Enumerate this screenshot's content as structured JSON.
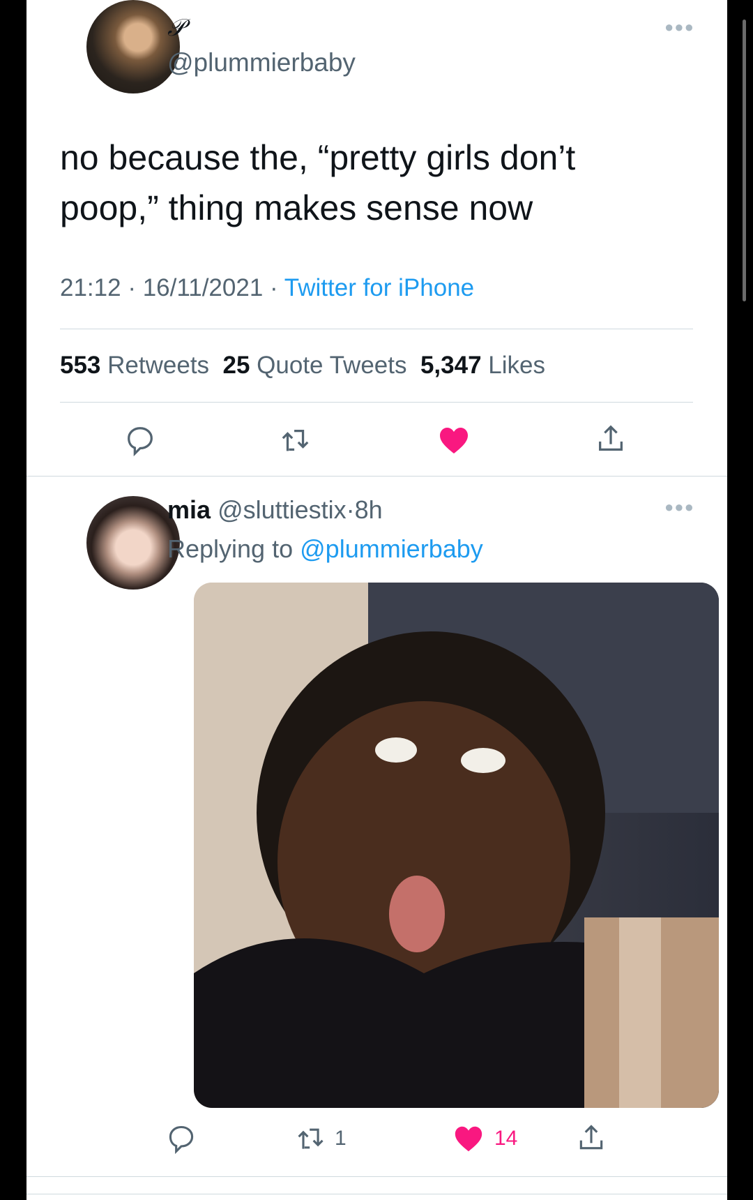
{
  "tweet": {
    "display_name": "𝒫",
    "handle": "@plummierbaby",
    "text_line1": "no because the, “pretty girls don’t",
    "text_line2": "poop,” thing makes sense now",
    "time": "21:12",
    "date": "16/11/2021",
    "source": "Twitter for iPhone",
    "retweets_count": "553",
    "retweets_label": "Retweets",
    "quotes_count": "25",
    "quotes_label": "Quote Tweets",
    "likes_count": "5,347",
    "likes_label": "Likes",
    "sep": "·"
  },
  "reply": {
    "display_name": "mia",
    "handle": "@sluttiestix",
    "age": "8h",
    "replying_label": "Replying to",
    "replying_handle": "@plummierbaby",
    "retweets": "1",
    "likes": "14"
  },
  "colors": {
    "like": "#f91880",
    "link": "#1d9bf0",
    "muted": "#536471"
  }
}
